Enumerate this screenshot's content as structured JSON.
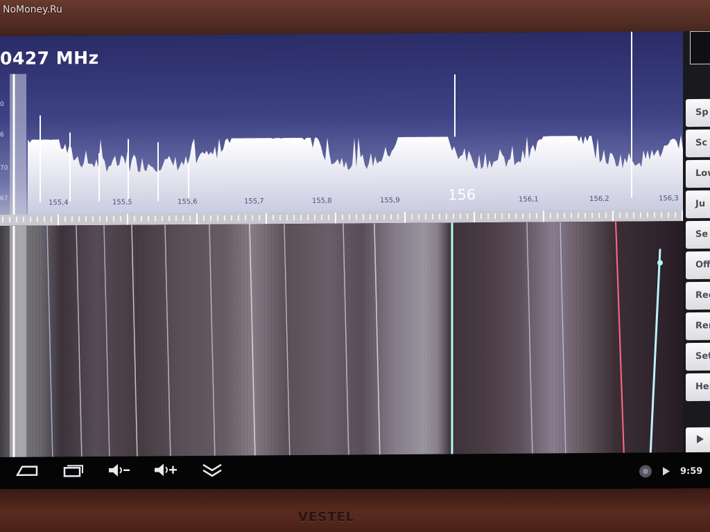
{
  "watermark": "NoMoney.Ru",
  "frequency_readout": "0427 MHz",
  "y_axis_labels": [
    "0",
    "6",
    "70",
    "67"
  ],
  "center_frequency_label": "156",
  "freq_ticks": [
    "155,4",
    "155,5",
    "155,6",
    "155,7",
    "155,8",
    "155,9",
    "156,1",
    "156,2",
    "156,3"
  ],
  "sidebar": {
    "buttons": [
      "Sp",
      "Sc",
      "Low",
      "Ju",
      "Se",
      "Off",
      "Rec",
      "Rem",
      "Setti",
      "Help"
    ],
    "play_icon": "play-icon"
  },
  "system_bar": {
    "icons": [
      "back-icon",
      "recent-apps-icon",
      "volume-down-icon",
      "volume-up-icon",
      "hide-icon"
    ],
    "time": "9:59"
  },
  "brand": "VESTEL"
}
